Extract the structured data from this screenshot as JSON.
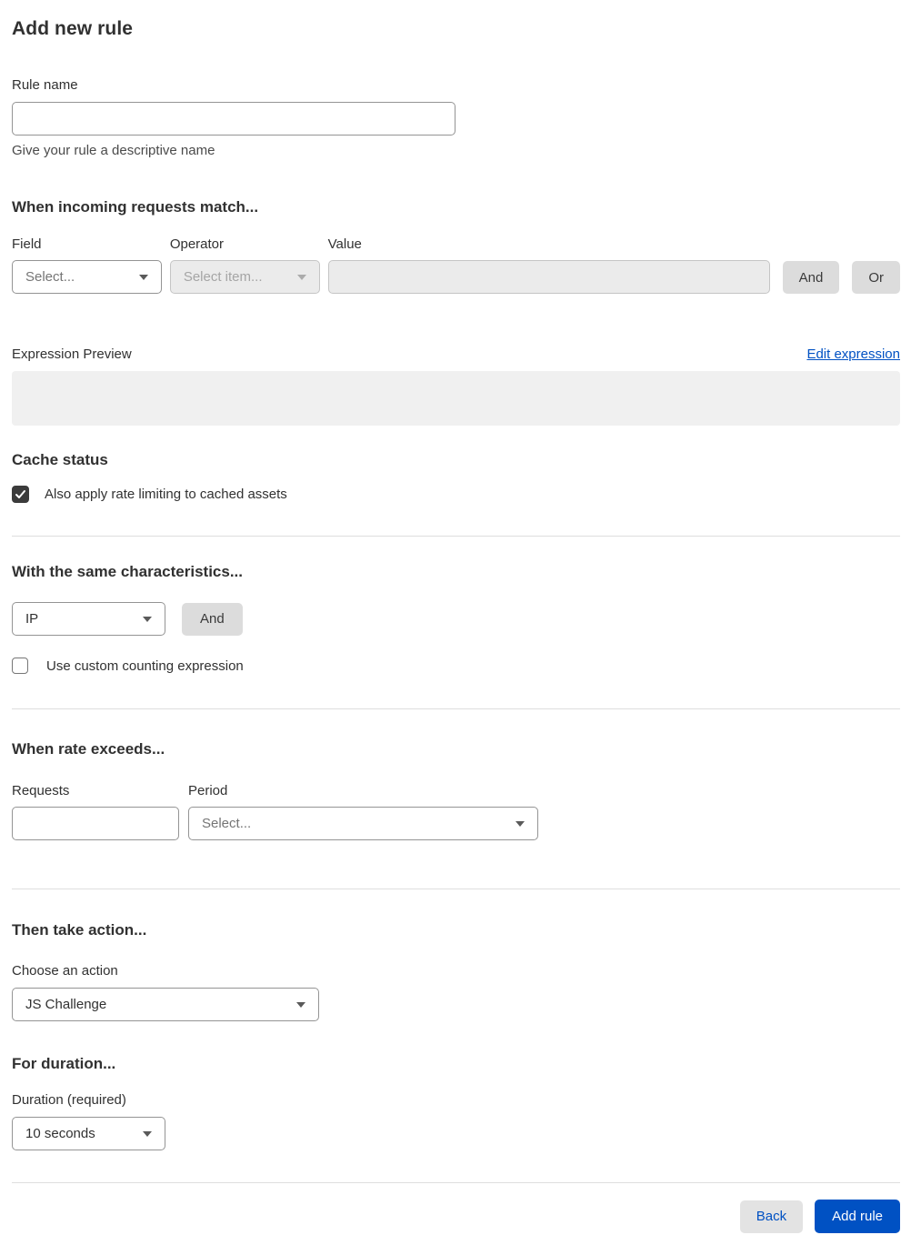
{
  "page": {
    "title": "Add new rule"
  },
  "colors": {
    "accent_blue": "#0051c3",
    "button_gray": "#dcdcdc",
    "disabled_bg": "#ebebeb",
    "preview_bg": "#f0f0f0",
    "checkbox_checked": "#3b3b3b"
  },
  "rule_name": {
    "label": "Rule name",
    "value": "",
    "placeholder": "",
    "helper": "Give your rule a descriptive name"
  },
  "match": {
    "heading": "When incoming requests match...",
    "field": {
      "label": "Field",
      "selected": "Select...",
      "is_placeholder": true
    },
    "operator": {
      "label": "Operator",
      "selected": "Select item...",
      "disabled": true
    },
    "value": {
      "label": "Value",
      "value": "",
      "disabled": true
    },
    "and_button": "And",
    "or_button": "Or"
  },
  "expression": {
    "label": "Expression Preview",
    "edit_link": "Edit expression",
    "content": ""
  },
  "cache_status": {
    "heading": "Cache status",
    "checkbox_label": "Also apply rate limiting to cached assets",
    "checked": true
  },
  "characteristics": {
    "heading": "With the same characteristics...",
    "select_value": "IP",
    "and_button": "And",
    "checkbox_label": "Use custom counting expression",
    "checked": false
  },
  "rate": {
    "heading": "When rate exceeds...",
    "requests": {
      "label": "Requests",
      "value": ""
    },
    "period": {
      "label": "Period",
      "selected": "Select...",
      "is_placeholder": true
    }
  },
  "action": {
    "heading": "Then take action...",
    "label": "Choose an action",
    "selected": "JS Challenge"
  },
  "duration": {
    "heading": "For duration...",
    "label": "Duration (required)",
    "selected": "10 seconds"
  },
  "footer": {
    "back_button": "Back",
    "add_button": "Add rule"
  }
}
